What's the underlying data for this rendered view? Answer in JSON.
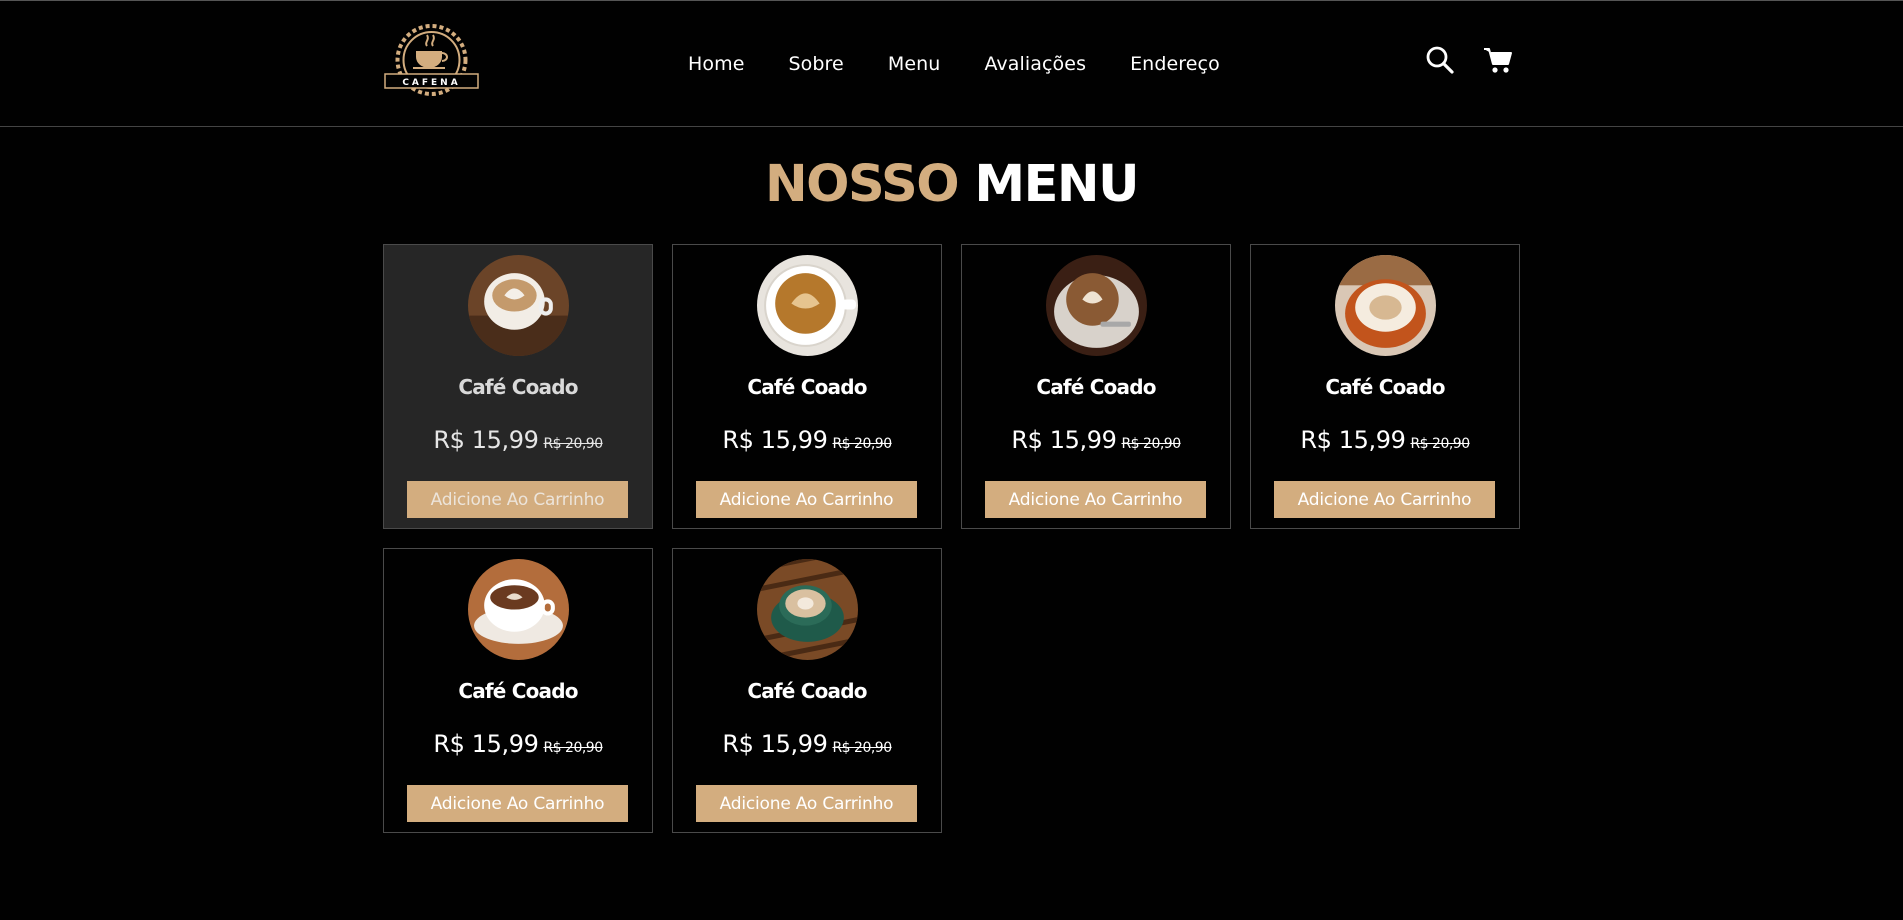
{
  "brand": {
    "logo_text": "CAFENA",
    "accent_color": "#d3ad7f"
  },
  "nav": {
    "items": [
      {
        "label": "Home"
      },
      {
        "label": "Sobre"
      },
      {
        "label": "Menu"
      },
      {
        "label": "Avaliações"
      },
      {
        "label": "Endereço"
      }
    ]
  },
  "header_icons": {
    "search": "search-icon",
    "cart": "cart-icon"
  },
  "section": {
    "title_accent": "NOSSO",
    "title_main": "MENU"
  },
  "products": [
    {
      "name": "Café Coado",
      "price": "R$ 15,99",
      "old_price": "R$ 20,90",
      "button": "Adicione Ao Carrinho"
    },
    {
      "name": "Café Coado",
      "price": "R$ 15,99",
      "old_price": "R$ 20,90",
      "button": "Adicione Ao Carrinho"
    },
    {
      "name": "Café Coado",
      "price": "R$ 15,99",
      "old_price": "R$ 20,90",
      "button": "Adicione Ao Carrinho"
    },
    {
      "name": "Café Coado",
      "price": "R$ 15,99",
      "old_price": "R$ 20,90",
      "button": "Adicione Ao Carrinho"
    },
    {
      "name": "Café Coado",
      "price": "R$ 15,99",
      "old_price": "R$ 20,90",
      "button": "Adicione Ao Carrinho"
    },
    {
      "name": "Café Coado",
      "price": "R$ 15,99",
      "old_price": "R$ 20,90",
      "button": "Adicione Ao Carrinho"
    }
  ]
}
